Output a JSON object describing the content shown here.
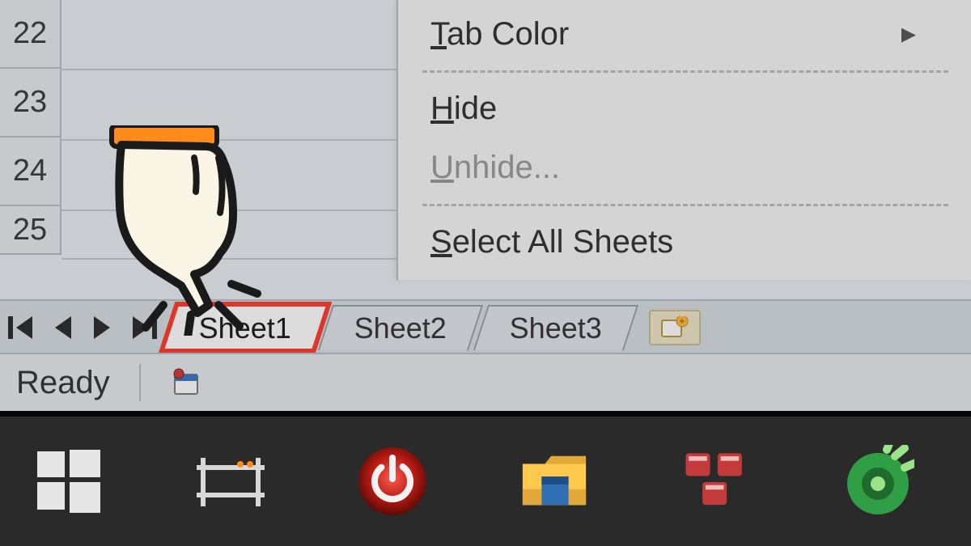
{
  "rows": [
    "22",
    "23",
    "24",
    "25"
  ],
  "context_menu": {
    "tab_color_label": "Tab Color",
    "hide_label": "Hide",
    "unhide_label": "Unhide...",
    "select_all_label": "Select All Sheets"
  },
  "tabs": {
    "sheet1": "Sheet1",
    "sheet2": "Sheet2",
    "sheet3": "Sheet3"
  },
  "status": {
    "ready": "Ready"
  }
}
